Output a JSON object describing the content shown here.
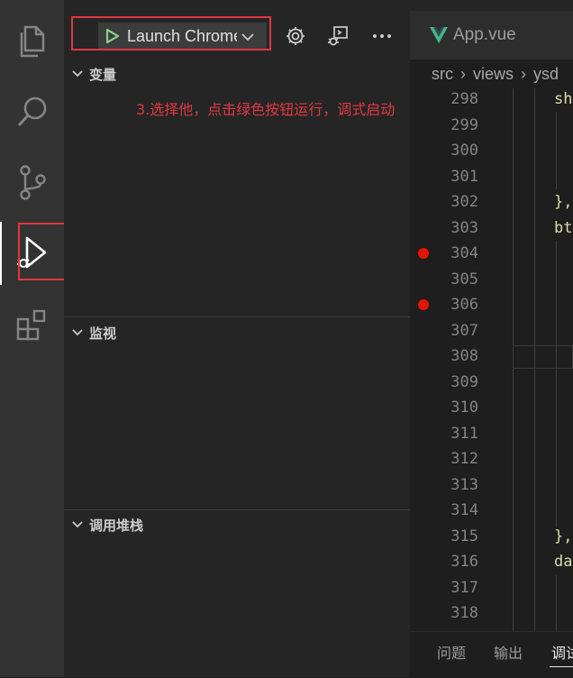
{
  "debug": {
    "config_label": "Launch Chrome",
    "sections": {
      "variables": "变量",
      "watch": "监视",
      "callstack": "调用堆栈"
    },
    "annotation": "3.选择他，点击绿色按钮运行，调式启动"
  },
  "editor": {
    "tab_name": "App.vue",
    "breadcrumb": [
      "src",
      "views",
      "ysd"
    ],
    "lines": [
      {
        "n": "298",
        "code": "sh",
        "bp": false
      },
      {
        "n": "299",
        "code": "",
        "bp": false
      },
      {
        "n": "300",
        "code": "",
        "bp": false
      },
      {
        "n": "301",
        "code": "",
        "bp": false
      },
      {
        "n": "302",
        "code": "},",
        "bp": false
      },
      {
        "n": "303",
        "code": "bt",
        "bp": false
      },
      {
        "n": "304",
        "code": "",
        "bp": true
      },
      {
        "n": "305",
        "code": "",
        "bp": false
      },
      {
        "n": "306",
        "code": "",
        "bp": true
      },
      {
        "n": "307",
        "code": "",
        "bp": false
      },
      {
        "n": "308",
        "code": "",
        "bp": false
      },
      {
        "n": "309",
        "code": "",
        "bp": false
      },
      {
        "n": "310",
        "code": "",
        "bp": false
      },
      {
        "n": "311",
        "code": "",
        "bp": false
      },
      {
        "n": "312",
        "code": "",
        "bp": false
      },
      {
        "n": "313",
        "code": "",
        "bp": false
      },
      {
        "n": "314",
        "code": "",
        "bp": false
      },
      {
        "n": "315",
        "code": "},",
        "bp": false
      },
      {
        "n": "316",
        "code": "da",
        "bp": false
      },
      {
        "n": "317",
        "code": "",
        "bp": false
      },
      {
        "n": "318",
        "code": "",
        "bp": false
      }
    ]
  },
  "panel": {
    "tabs": [
      "问题",
      "输出",
      "调试"
    ]
  },
  "icons": {
    "explorer": "files-icon",
    "search": "search-icon",
    "scm": "source-control-icon",
    "debug": "run-debug-icon",
    "extensions": "extensions-icon",
    "gear": "gear-icon",
    "debug_console": "debug-console-icon",
    "more": "more-icon"
  },
  "colors": {
    "accent_green": "#89d185",
    "annotation_red": "#e0383e",
    "breakpoint": "#e51400",
    "vue_green": "#41b883"
  }
}
